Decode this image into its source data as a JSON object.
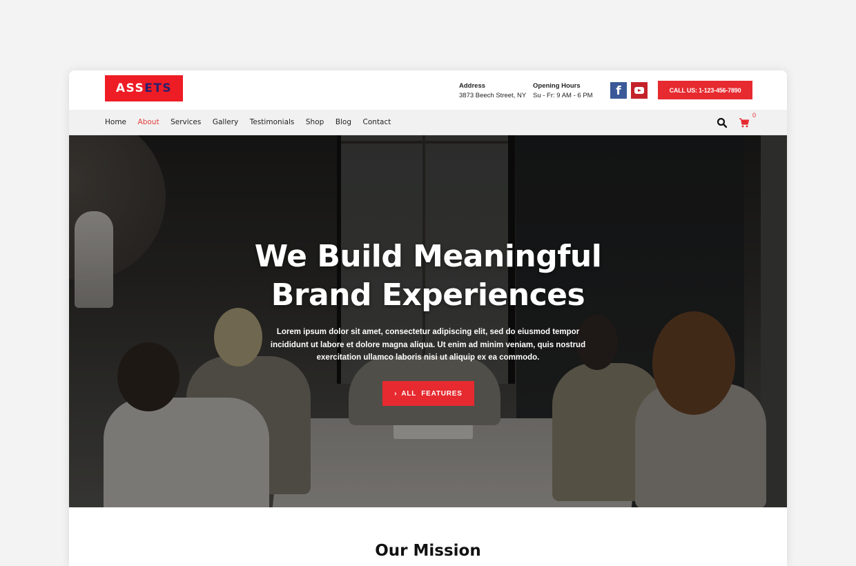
{
  "header": {
    "logo": {
      "part1": "ASS",
      "part2": "ETS"
    },
    "address": {
      "label": "Address",
      "value": "3873 Beech Street, NY"
    },
    "hours": {
      "label": "Opening Hours",
      "value": "Su - Fr: 9 AM - 6 PM"
    },
    "social": [
      {
        "name": "facebook",
        "glyph": "f"
      },
      {
        "name": "youtube"
      }
    ],
    "call_button": "CALL US: 1-123-456-7890"
  },
  "nav": {
    "items": [
      {
        "label": "Home",
        "active": false
      },
      {
        "label": "About",
        "active": true
      },
      {
        "label": "Services",
        "active": false
      },
      {
        "label": "Gallery",
        "active": false
      },
      {
        "label": "Testimonials",
        "active": false
      },
      {
        "label": "Shop",
        "active": false
      },
      {
        "label": "Blog",
        "active": false
      },
      {
        "label": "Contact",
        "active": false
      }
    ],
    "cart_count": "0"
  },
  "hero": {
    "title_line1": "We Build Meaningful",
    "title_line2": "Brand Experiences",
    "text": "Lorem ipsum dolor sit amet, consectetur adipiscing elit, sed do eiusmod tempor incididunt ut labore et dolore magna aliqua. Ut enim ad minim veniam, quis nostrud exercitation ullamco laboris nisi ut aliquip ex ea commodo.",
    "button_chevron": "›",
    "button_label": "ALL  FEATURES"
  },
  "mission": {
    "title": "Our Mission"
  },
  "colors": {
    "accent": "#e62a2f",
    "logo_dark": "#2a1f6e",
    "facebook": "#3b5998",
    "youtube": "#c4232b"
  }
}
